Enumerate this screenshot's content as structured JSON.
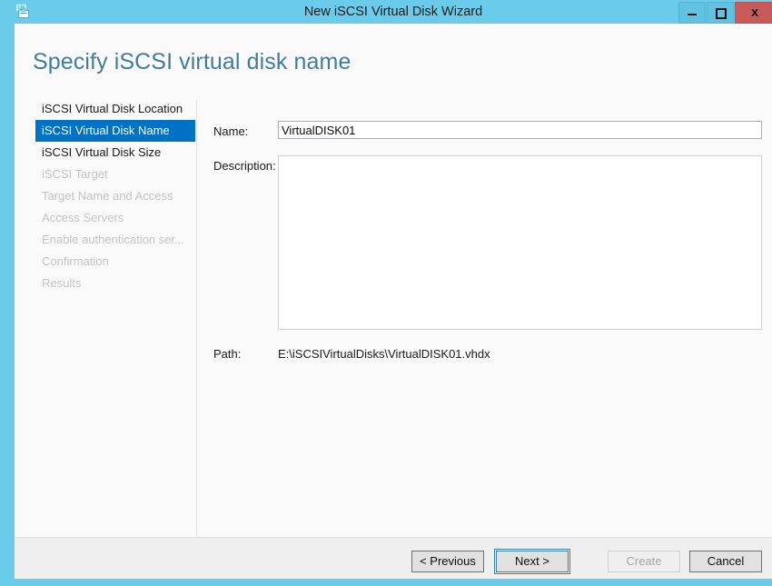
{
  "window": {
    "title": "New iSCSI Virtual Disk Wizard",
    "icon": "iscsi-disk-icon",
    "accent_color": "#6BCBEA",
    "controls": {
      "minimize": "minimize-icon",
      "maximize": "maximize-icon",
      "close_label": "x"
    }
  },
  "page": {
    "heading": "Specify iSCSI virtual disk name",
    "heading_color": "#3f7d9e"
  },
  "sidebar": {
    "selected_color": "#0072C6",
    "items": [
      {
        "label": "iSCSI Virtual Disk Location",
        "state": "enabled"
      },
      {
        "label": "iSCSI Virtual Disk Name",
        "state": "selected"
      },
      {
        "label": "iSCSI Virtual Disk Size",
        "state": "enabled"
      },
      {
        "label": "iSCSI Target",
        "state": "disabled"
      },
      {
        "label": "Target Name and Access",
        "state": "disabled"
      },
      {
        "label": "Access Servers",
        "state": "disabled"
      },
      {
        "label": "Enable authentication ser...",
        "state": "disabled"
      },
      {
        "label": "Confirmation",
        "state": "disabled"
      },
      {
        "label": "Results",
        "state": "disabled"
      }
    ]
  },
  "form": {
    "name": {
      "label": "Name:",
      "value": "VirtualDISK01",
      "placeholder": ""
    },
    "description": {
      "label": "Description:",
      "value": "",
      "placeholder": ""
    },
    "path": {
      "label": "Path:",
      "value": "E:\\iSCSIVirtualDisks\\VirtualDISK01.vhdx"
    }
  },
  "footer": {
    "buttons": [
      {
        "label": "< Previous",
        "state": "enabled"
      },
      {
        "label": "Next >",
        "state": "focused"
      },
      {
        "label": "Create",
        "state": "disabled"
      },
      {
        "label": "Cancel",
        "state": "enabled"
      }
    ]
  }
}
